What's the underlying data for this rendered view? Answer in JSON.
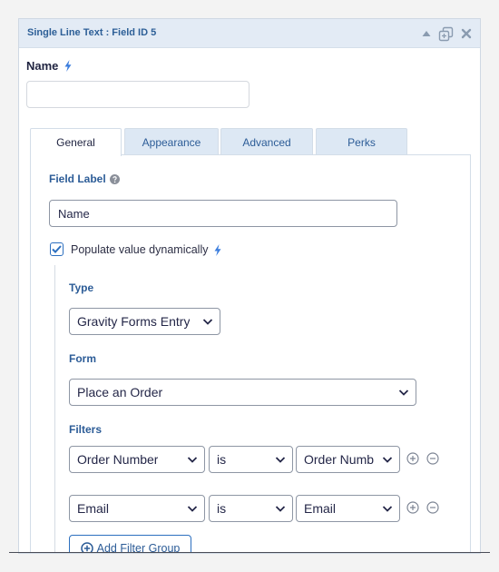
{
  "header": {
    "title": "Single Line Text : Field ID 5",
    "icons": [
      "collapse-icon",
      "duplicate-icon",
      "delete-icon"
    ]
  },
  "name_setting": {
    "label": "Name",
    "value": "",
    "placeholder": ""
  },
  "tabs": [
    {
      "label": "General",
      "active": true
    },
    {
      "label": "Appearance",
      "active": false
    },
    {
      "label": "Advanced",
      "active": false
    },
    {
      "label": "Perks",
      "active": false
    }
  ],
  "general": {
    "field_label": {
      "label": "Field Label",
      "value": "Name"
    },
    "populate": {
      "label": "Populate value dynamically",
      "checked": true
    },
    "type": {
      "label": "Type",
      "selected": "Gravity Forms Entry"
    },
    "form": {
      "label": "Form",
      "selected": "Place an Order"
    },
    "filters": {
      "label": "Filters",
      "rows": [
        {
          "property": "Order Number",
          "operator": "is",
          "value": "Order Numb"
        },
        {
          "property": "Email",
          "operator": "is",
          "value": "Email"
        }
      ],
      "add_group_label": "Add Filter Group"
    }
  },
  "colors": {
    "accent": "#2c5c97",
    "link_blue": "#2c6fbf",
    "header_bg": "#e3ebf5",
    "tab_bg": "#dde8f4"
  }
}
